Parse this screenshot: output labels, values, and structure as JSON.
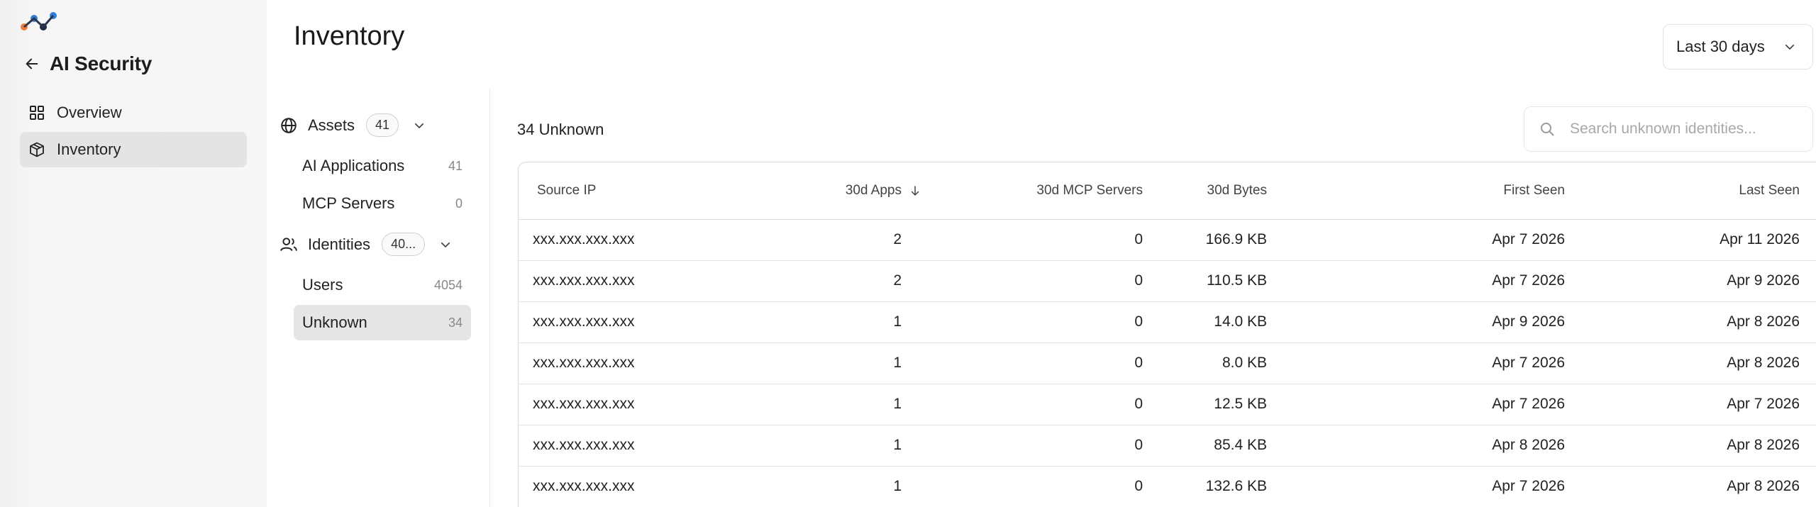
{
  "sidebar": {
    "back_title": "AI Security",
    "nav": [
      {
        "label": "Overview",
        "icon": "grid-icon",
        "active": false
      },
      {
        "label": "Inventory",
        "icon": "cube-icon",
        "active": true
      }
    ]
  },
  "header": {
    "title": "Inventory",
    "range": "Last 30 days"
  },
  "filters": {
    "assets": {
      "label": "Assets",
      "count": "41"
    },
    "asset_items": [
      {
        "label": "AI Applications",
        "count": "41"
      },
      {
        "label": "MCP Servers",
        "count": "0"
      }
    ],
    "identities": {
      "label": "Identities",
      "count": "40..."
    },
    "identity_items": [
      {
        "label": "Users",
        "count": "4054"
      },
      {
        "label": "Unknown",
        "count": "34",
        "active": true
      }
    ]
  },
  "main": {
    "result_count": "34 Unknown",
    "search_placeholder": "Search unknown identities...",
    "columns": [
      "Source IP",
      "30d Apps",
      "30d MCP Servers",
      "30d Bytes",
      "First Seen",
      "Last Seen"
    ],
    "rows": [
      [
        "xxx.xxx.xxx.xxx",
        "2",
        "0",
        "166.9 KB",
        "Apr 7 2026",
        "Apr 11 2026"
      ],
      [
        "xxx.xxx.xxx.xxx",
        "2",
        "0",
        "110.5 KB",
        "Apr 7 2026",
        "Apr 9 2026"
      ],
      [
        "xxx.xxx.xxx.xxx",
        "1",
        "0",
        "14.0 KB",
        "Apr 9 2026",
        "Apr 8 2026"
      ],
      [
        "xxx.xxx.xxx.xxx",
        "1",
        "0",
        "8.0 KB",
        "Apr 7 2026",
        "Apr 8 2026"
      ],
      [
        "xxx.xxx.xxx.xxx",
        "1",
        "0",
        "12.5 KB",
        "Apr 7 2026",
        "Apr 7 2026"
      ],
      [
        "xxx.xxx.xxx.xxx",
        "1",
        "0",
        "85.4 KB",
        "Apr 8 2026",
        "Apr 8 2026"
      ],
      [
        "xxx.xxx.xxx.xxx",
        "1",
        "0",
        "132.6 KB",
        "Apr 7 2026",
        "Apr 8 2026"
      ]
    ]
  },
  "colors": {
    "logo_orange": "#f07a3a",
    "logo_blue": "#2f7fd6",
    "logo_dark": "#1f2a44",
    "active_bg": "#e4e4e4"
  }
}
